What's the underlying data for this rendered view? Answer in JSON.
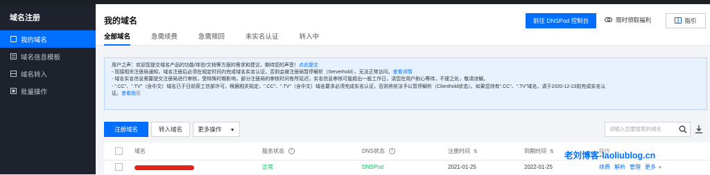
{
  "sidebar": {
    "title": "域名注册",
    "items": [
      {
        "label": "我的域名",
        "icon": "file-icon"
      },
      {
        "label": "域名信息模板",
        "icon": "template-icon"
      },
      {
        "label": "域名转入",
        "icon": "transfer-icon"
      },
      {
        "label": "批量操作",
        "icon": "batch-icon"
      }
    ]
  },
  "header": {
    "title": "我的域名",
    "tabs": [
      "全部域名",
      "急需续费",
      "急需赎回",
      "未实名认证",
      "转入中"
    ],
    "dnspod_button": "前往 DNSPod 控制台",
    "gift_label": "限时领取福利",
    "guide_button": "指引"
  },
  "notice": {
    "line1_prefix": "用户之声：欢迎您提交域名产品的功能/体验/文档等方面的需求和建议，期待您的声音！",
    "line1_link": "点此提交",
    "line2": "- 现接相关注册局通知，域名注册后必须在规定时间内完成域名实名认证，否则会被注册局暂停解析（Serverhold），无法正常访问。",
    "line2_link": "查看详情",
    "line3": "- 域名实名信息需要提交注册局进行审核，受特殊时期影响，部分注册局的审核时间有所延迟，实名信息审核可能超出一般工作日，请您在用户耐心等待，不便之处，敬请谅解。",
    "line4": "- \".CC\"、\".TV\"（含中文）域名已于日前获工信部许可，根据相关规定，\".CC\"、\".TV\"（含中文）域名要求必须完成实名认证，否则将依法予以暂停解析（Clienthold状态）。如果您持有\".CC\"、\".TV\"域名，请于2020-12-23前完成实名认",
    "line5_prefix": "证。",
    "line5_link": "查看指引"
  },
  "toolbar": {
    "register_button": "注册域名",
    "transfer_button": "转入域名",
    "more_button": "更多操作",
    "search_placeholder": "请输入您要搜索的域名"
  },
  "table": {
    "columns": [
      "域名",
      "服务状态",
      "DNS状态",
      "注册时间",
      "到期时间",
      "操作"
    ],
    "rows": [
      {
        "service_status": "正常",
        "dns_status": "DNSPod",
        "registered": "2021-01-25",
        "expires": "2022-01-25",
        "actions": [
          "续费",
          "解析",
          "管理",
          "更多"
        ]
      }
    ]
  },
  "watermark": "老刘博客-laoliublog.cn",
  "colors": {
    "accent": "#006eff",
    "sidebar_bg": "#1e222d",
    "status_green": "#0abf5b"
  }
}
